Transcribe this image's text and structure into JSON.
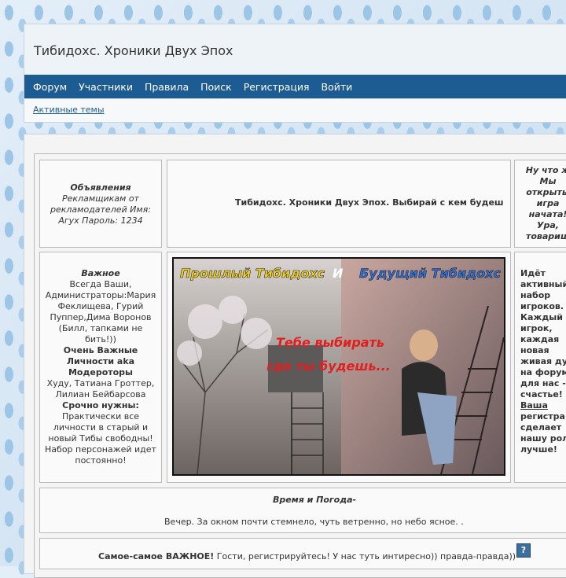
{
  "site": {
    "title": "Тибидохс. Хроники Двух Эпох"
  },
  "nav": [
    "Форум",
    "Участники",
    "Правила",
    "Поиск",
    "Регистрация",
    "Войти"
  ],
  "subnav": {
    "active_topics": "Активные темы"
  },
  "announcements": {
    "heading": "Объявления",
    "body": "Рекламщикам от рекламодателей Имя: Агух Пароль: 1234"
  },
  "center_title": "Тибидохс. Хроники Двух Эпох. Выбирай с кем будеш",
  "right_top": [
    "Ну что ж",
    "Мы",
    "открыты",
    "игра",
    "начата!",
    "Ура,",
    "товарищ"
  ],
  "important": {
    "heading": "Важное",
    "line1": "Всегда Ваши, Администраторы:Мария Феклищева, Гурий Пуппер,Дима Воронов (Билл, тапками не бить!))",
    "mods_heading": "Очень Важные Личности aka Модероторы",
    "mods": "Худу, Татиана Гроттер, Лилиан Бейбарсова",
    "urgent_heading": "Срочно нужны:",
    "urgent": "Практически все личности в старый и новый Тибы свободны! Набор персонажей идет постоянно!"
  },
  "banner": {
    "left_title": "Прошлый Тибидохс",
    "and": "И",
    "right_title": "Будущий Тибидохс",
    "middle1": "Тебе выбирать",
    "middle2": "где ты будешь..."
  },
  "right_mid": {
    "lines": [
      "Идёт",
      "активный",
      "набор",
      "игроков.",
      "Каждый",
      "игрок,",
      "каждая",
      "новая",
      "живая ду",
      "на форум",
      "для нас -",
      "счастье!"
    ],
    "link": "Ваша",
    "tail": [
      "регистра",
      "сделает",
      "нашу рол",
      "лучше!"
    ]
  },
  "weather": {
    "heading": "Время и Погода-",
    "text": "Вечер. За окном почти стемнело, чуть ветренно, но небо ясное. ."
  },
  "important_strip": {
    "bold": "Самое-самое ВАЖНОЕ!",
    "text": " Гости, регистрируйтесь! У нас туть интиресно)) правда-правда))",
    "help_icon": "?"
  }
}
